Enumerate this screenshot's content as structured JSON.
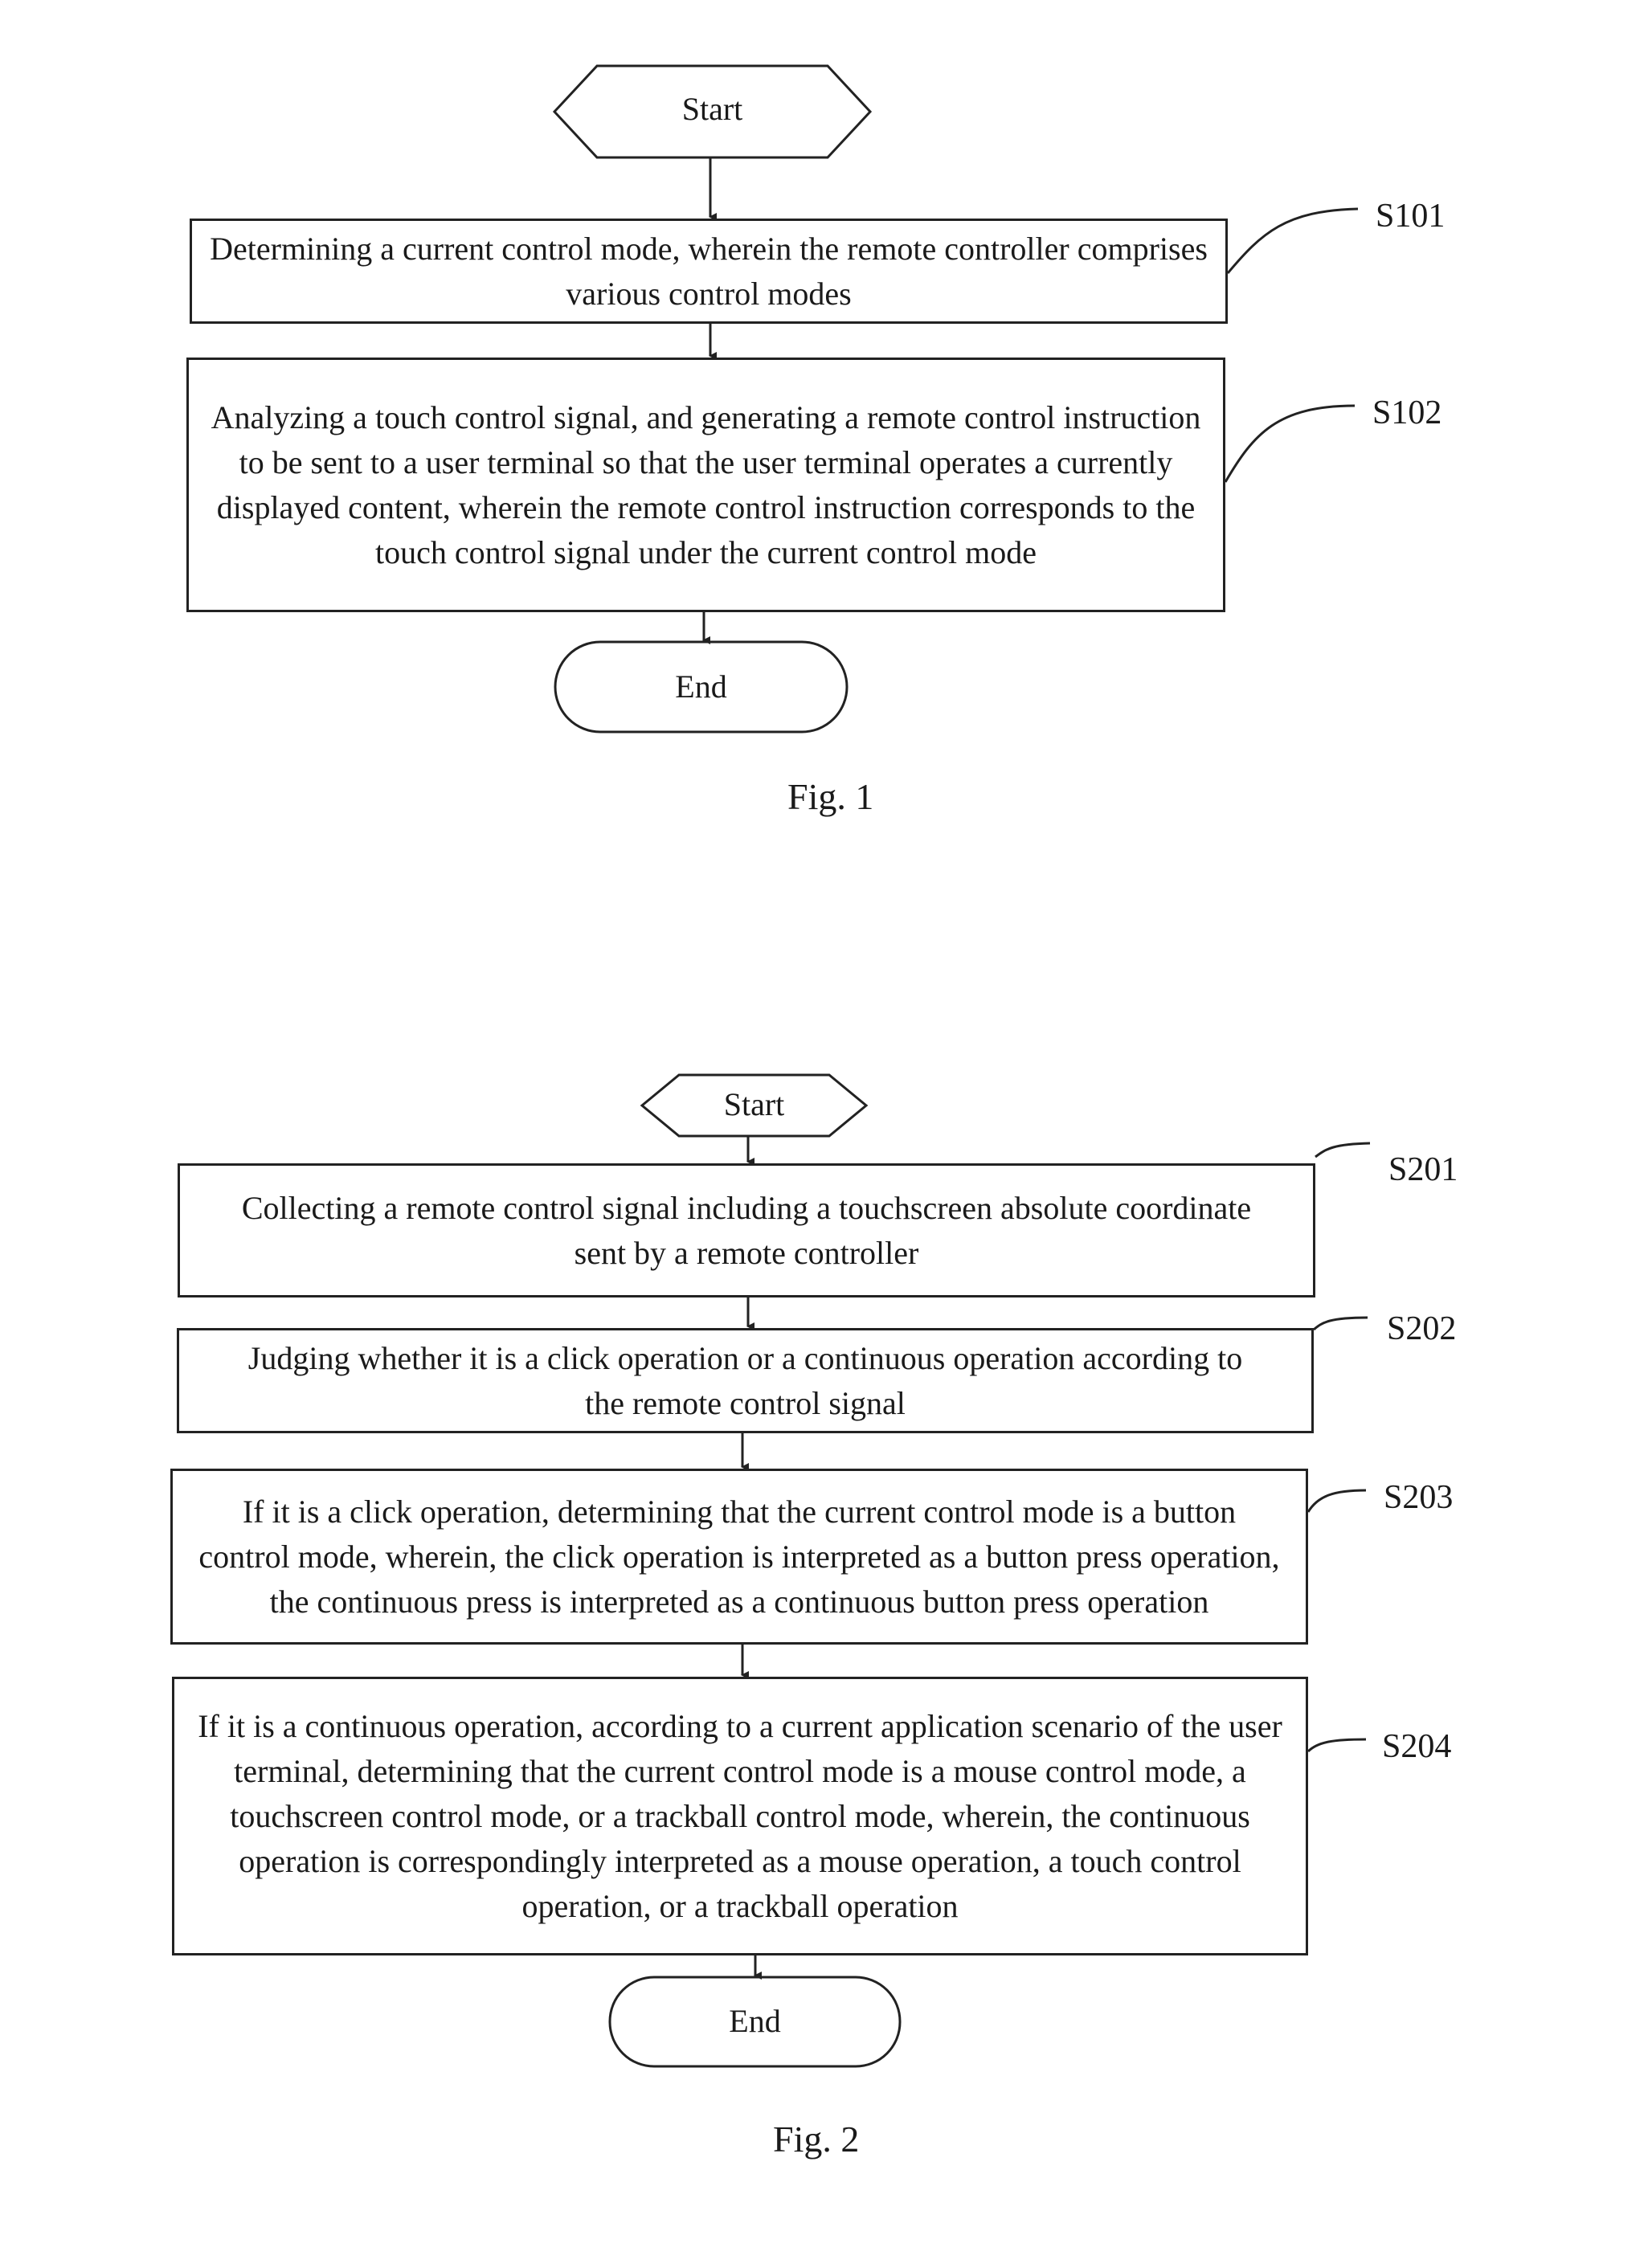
{
  "figures": [
    {
      "caption": "Fig. 1",
      "start_label": "Start",
      "end_label": "End",
      "steps": [
        {
          "id": "S101",
          "text": "Determining a current control mode, wherein the remote controller comprises various control modes"
        },
        {
          "id": "S102",
          "text": "Analyzing a touch control signal, and generating a remote control instruction to be sent to a user terminal so that the user terminal operates a currently displayed content, wherein the remote control instruction corresponds to the touch control signal under the current control mode"
        }
      ]
    },
    {
      "caption": "Fig. 2",
      "start_label": "Start",
      "end_label": "End",
      "steps": [
        {
          "id": "S201",
          "text": "Collecting a remote control signal including a touchscreen absolute coordinate sent by a remote controller"
        },
        {
          "id": "S202",
          "text": "Judging whether it is a click operation or a continuous operation according to the remote control signal"
        },
        {
          "id": "S203",
          "text": "If it is a click operation, determining that the current control mode is a button control mode, wherein, the click operation is interpreted as a button press operation, the continuous press is interpreted as a continuous button press operation"
        },
        {
          "id": "S204",
          "text": "If it is a continuous operation, according to a current application scenario of the user terminal, determining that the current control mode is a mouse control mode, a touchscreen control mode, or a trackball control mode, wherein, the continuous operation is correspondingly interpreted as a mouse operation, a touch control operation, or a trackball operation"
        }
      ]
    }
  ]
}
